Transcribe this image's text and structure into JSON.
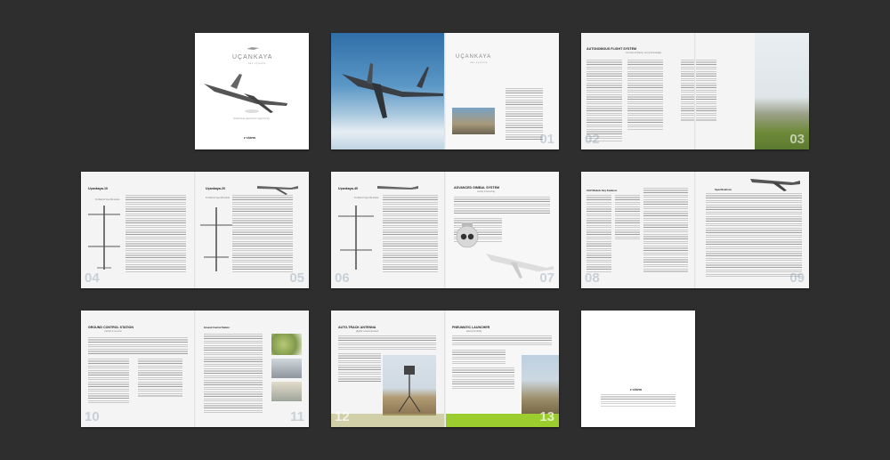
{
  "cover": {
    "logo": "UÇANKAYA",
    "logo_sub": "uav systems",
    "tagline": "Situational Awareness Superiority",
    "brand": "z-sistem"
  },
  "spread_01": {
    "logo": "UÇANKAYA",
    "logo_sub": "uav systems",
    "page_left": "",
    "page_right": "01"
  },
  "spread_02": {
    "title": "AUTONOMOUS FLIGHT SYSTEM",
    "subtitle": "not only airframe, out of knowledge",
    "page_left": "02",
    "page_right": "03"
  },
  "spread_04": {
    "title_left": "Uçankaya-10",
    "title_right": "Uçankaya-20",
    "spec_label_left": "Technical Specifications",
    "spec_label_right": "Technical Specifications",
    "page_left": "04",
    "page_right": "05"
  },
  "spread_06": {
    "title_left": "Uçankaya-40",
    "spec_label": "Technical Specifications",
    "title_right": "ADVANCED GIMBAL SYSTEM",
    "subtitle_right": "seeing is knowing",
    "page_left": "06",
    "page_right": "07"
  },
  "spread_08": {
    "title_left": "UAV Models Key Features",
    "spec_label": "Specifications",
    "page_left": "08",
    "page_right": "09"
  },
  "spread_10": {
    "title": "GROUND CONTROL STATION",
    "subtitle": "control is success",
    "table_title": "Ground Control Station",
    "page_left": "10",
    "page_right": "11"
  },
  "spread_12": {
    "title_left": "AUTO-TRACK ANTENNA",
    "subtitle_left": "digital communication",
    "title_right": "PNEUMATIC LAUNCHER",
    "subtitle_right": "takeoff mobility",
    "page_left": "12",
    "page_right": "13"
  },
  "back_cover": {
    "brand": "z-sistem"
  },
  "colors": {
    "background": "#2e2e2e",
    "page": "#f4f4f4",
    "accent_green": "#9ccd2e",
    "sky_blue": "#4a86b8"
  }
}
